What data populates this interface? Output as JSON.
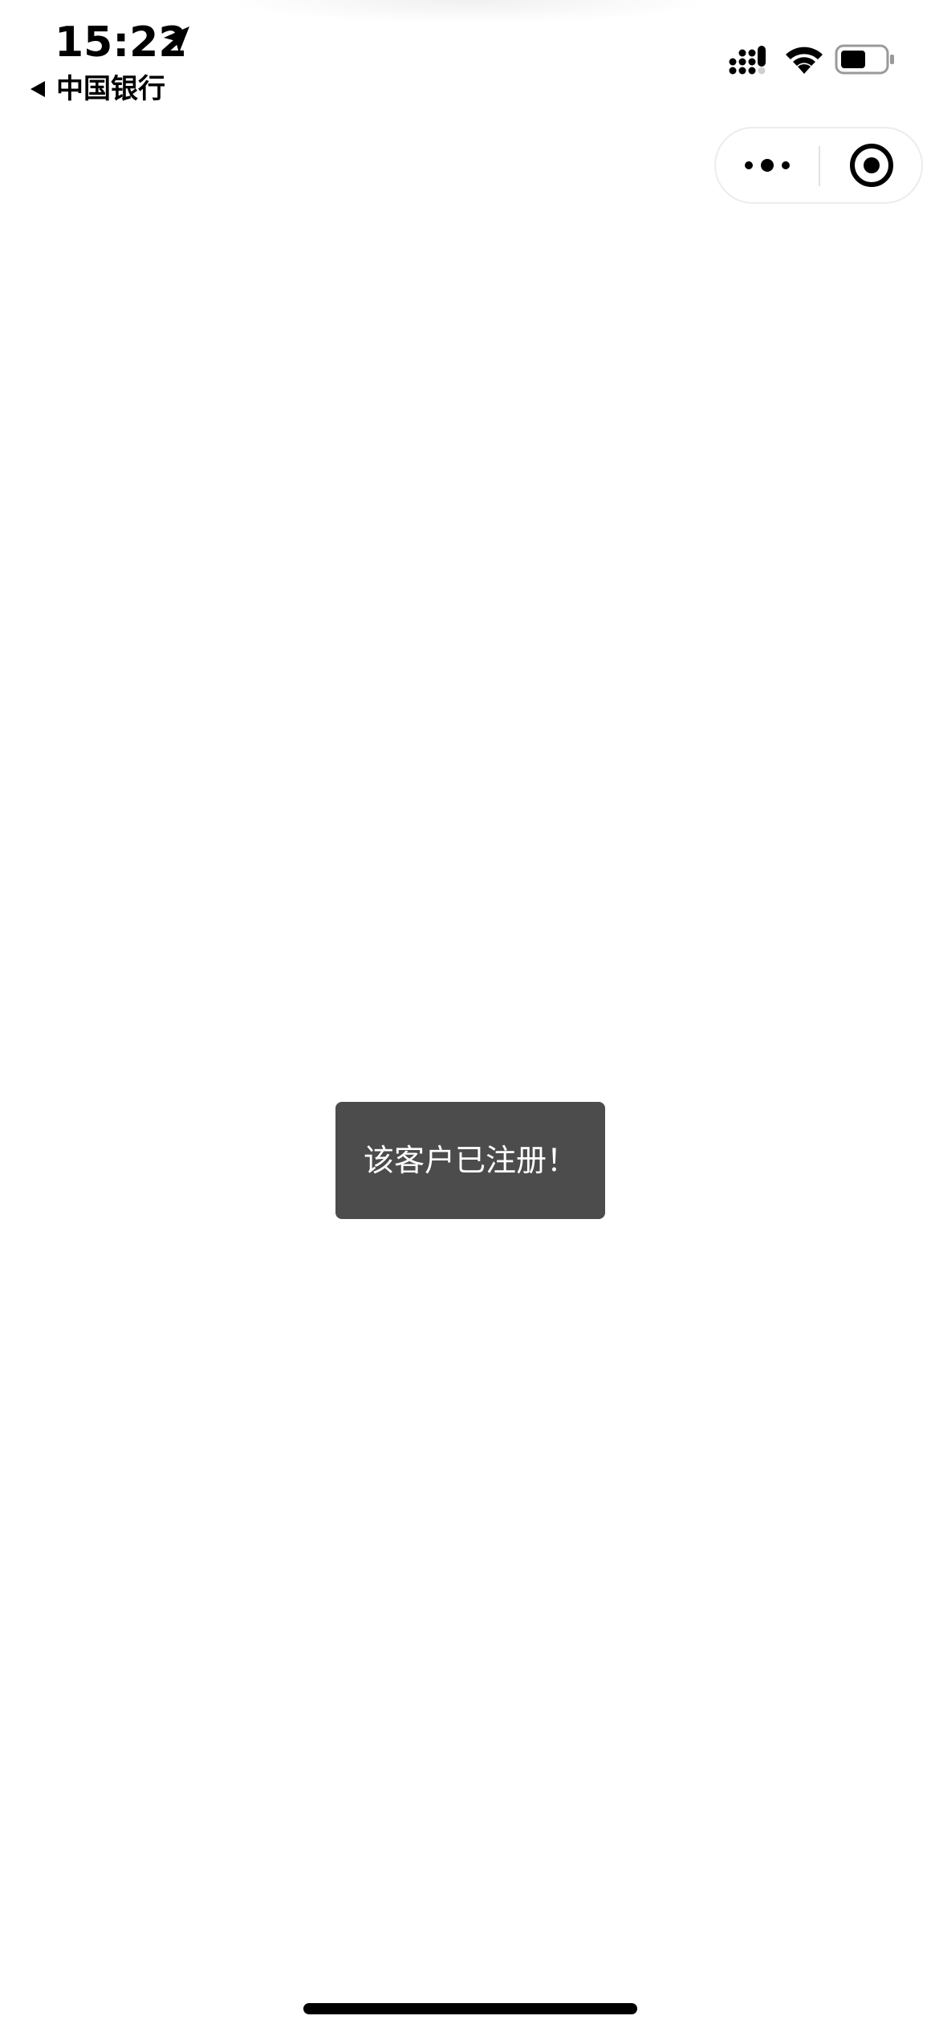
{
  "status_bar": {
    "time": "15:22",
    "back_label": "中国银行",
    "icons": [
      "location-arrow-icon",
      "cellular-signal-icon",
      "wifi-icon",
      "battery-icon"
    ]
  },
  "capsule": {
    "icons": [
      "more-dots-icon",
      "close-target-icon"
    ]
  },
  "toast": {
    "message": "该客户已注册！"
  },
  "colors": {
    "background": "#ffffff",
    "toast_background": "#4c4c4c",
    "toast_text": "#ffffff",
    "capsule_border": "#ececec",
    "foreground": "#000000"
  }
}
